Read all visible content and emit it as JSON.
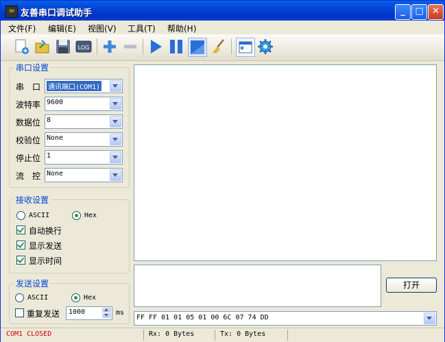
{
  "window": {
    "title": "友善串口调试助手",
    "icon_text": "SH"
  },
  "title_buttons": {
    "minimize": "_",
    "maximize": "□",
    "close": "✕"
  },
  "menu": [
    "文件(F)",
    "编辑(E)",
    "视图(V)",
    "工具(T)",
    "帮助(H)"
  ],
  "toolbar": [
    "new-icon",
    "open-icon",
    "save-icon",
    "log-icon",
    "add-icon",
    "remove-icon",
    "play-icon",
    "pause-icon",
    "window-icon",
    "clear-broom-icon",
    "layout-icon",
    "settings-gear-icon"
  ],
  "toolbar_log_text": "LOG",
  "serial": {
    "title": "串口设置",
    "fields": [
      {
        "label": "串　口",
        "value": "通讯端口(COM1)"
      },
      {
        "label": "波特率",
        "value": "9600"
      },
      {
        "label": "数据位",
        "value": "8"
      },
      {
        "label": "校验位",
        "value": "None"
      },
      {
        "label": "停止位",
        "value": "1"
      },
      {
        "label": "流　控",
        "value": "None"
      }
    ]
  },
  "receive": {
    "title": "接收设置",
    "ascii": "ASCII",
    "hex": "Hex",
    "mode_selected": "Hex",
    "options": [
      {
        "label": "自动换行",
        "checked": true
      },
      {
        "label": "显示发送",
        "checked": true
      },
      {
        "label": "显示时间",
        "checked": true
      }
    ]
  },
  "send": {
    "title": "发送设置",
    "ascii": "ASCII",
    "hex": "Hex",
    "mode_selected": "Hex",
    "repeat_label": "重复发送",
    "repeat_checked": false,
    "interval": "1000",
    "unit": "ms"
  },
  "open_button": "打开",
  "history": "FF FF 01 01 05 01 00 6C 07 74 DD",
  "status": {
    "port": "COM1 CLOSED",
    "rx": "Rx: 0 Bytes",
    "tx": "Tx: 0 Bytes"
  },
  "colors": {
    "title_bar": "#0044d4",
    "group_title": "#0046d5",
    "status_closed": "#d40000",
    "check_mark": "#21a121"
  }
}
